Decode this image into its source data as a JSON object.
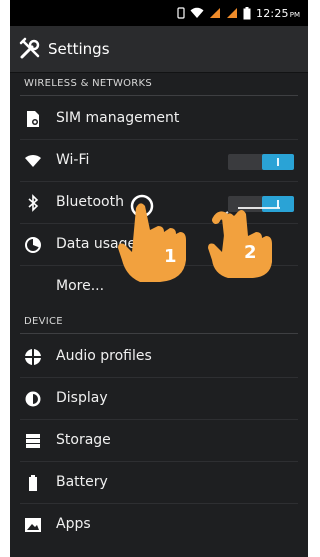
{
  "status_bar": {
    "time": "12:25",
    "ampm": "PM"
  },
  "action_bar": {
    "title": "Settings"
  },
  "sections": {
    "wireless": "WIRELESS & NETWORKS",
    "device": "DEVICE"
  },
  "items": {
    "sim": "SIM management",
    "wifi": "Wi-Fi",
    "bluetooth": "Bluetooth",
    "data_usage": "Data usage",
    "more": "More...",
    "audio": "Audio profiles",
    "display": "Display",
    "storage": "Storage",
    "battery": "Battery",
    "apps": "Apps"
  },
  "toggles": {
    "wifi_on": true,
    "bluetooth_on": true
  },
  "hands": {
    "first": "1",
    "second": "2"
  },
  "colors": {
    "accent": "#2aa3d6",
    "hand": "#f2a13e"
  }
}
